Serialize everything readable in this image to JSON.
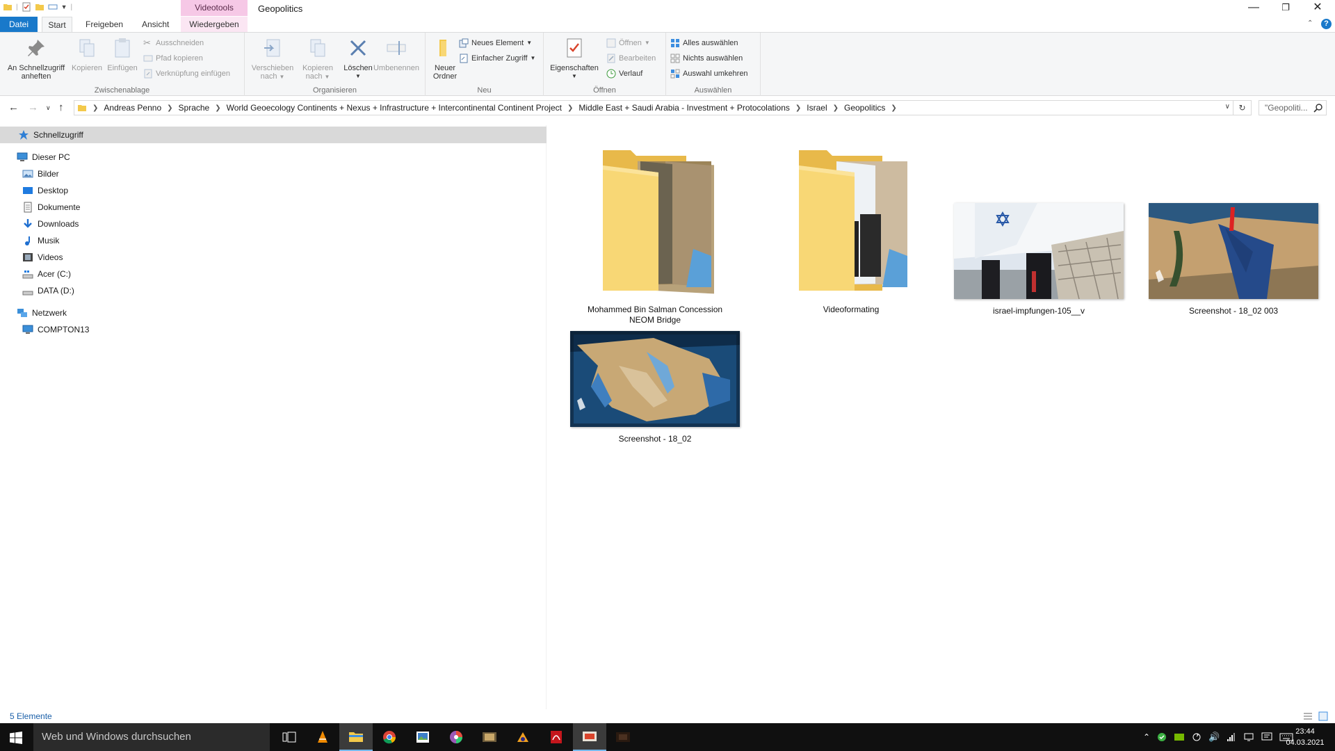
{
  "window": {
    "title": "Geopolitics",
    "context_tab_header": "Videotools"
  },
  "tabs": [
    {
      "label": "Datei"
    },
    {
      "label": "Start"
    },
    {
      "label": "Freigeben"
    },
    {
      "label": "Ansicht"
    },
    {
      "label": "Wiedergeben"
    }
  ],
  "ribbon": {
    "clipboard": {
      "group": "Zwischenablage",
      "pin_line1": "An Schnellzugriff",
      "pin_line2": "anheften",
      "copy": "Kopieren",
      "paste": "Einfügen",
      "cut": "Ausschneiden",
      "copy_path": "Pfad kopieren",
      "paste_shortcut": "Verknüpfung einfügen"
    },
    "organize": {
      "group": "Organisieren",
      "move_line1": "Verschieben",
      "move_line2": "nach",
      "copyto_line1": "Kopieren",
      "copyto_line2": "nach",
      "delete": "Löschen",
      "rename": "Umbenennen"
    },
    "new": {
      "group": "Neu",
      "folder_line1": "Neuer",
      "folder_line2": "Ordner",
      "new_item": "Neues Element",
      "easy_access": "Einfacher Zugriff"
    },
    "open": {
      "group": "Öffnen",
      "properties": "Eigenschaften",
      "open": "Öffnen",
      "edit": "Bearbeiten",
      "history": "Verlauf"
    },
    "select": {
      "group": "Auswählen",
      "all": "Alles auswählen",
      "none": "Nichts auswählen",
      "invert": "Auswahl umkehren"
    }
  },
  "address": {
    "crumbs": [
      "Andreas Penno",
      "Sprache",
      "World Geoecology Continents + Nexus + Infrastructure + Intercontinental Continent Project",
      "Middle East + Saudi Arabia - Investment + Protocolations",
      "Israel",
      "Geopolitics"
    ],
    "search_placeholder": "\"Geopoliti..."
  },
  "nav": {
    "quick_access": "Schnellzugriff",
    "this_pc": "Dieser PC",
    "pc_items": [
      "Bilder",
      "Desktop",
      "Dokumente",
      "Downloads",
      "Musik",
      "Videos",
      "Acer (C:)",
      "DATA (D:)"
    ],
    "network": "Netzwerk",
    "network_items": [
      "COMPTON13"
    ]
  },
  "items": [
    {
      "name": "Mohammed Bin Salman Concession NEOM Bridge",
      "kind": "folder"
    },
    {
      "name": "Videoformating",
      "kind": "folder"
    },
    {
      "name": "israel-impfungen-105__v",
      "kind": "image"
    },
    {
      "name": "Screenshot - 18_02 003",
      "kind": "image"
    },
    {
      "name": "Screenshot - 18_02",
      "kind": "image"
    }
  ],
  "status": {
    "count": "5 Elemente"
  },
  "taskbar": {
    "search_placeholder": "Web und Windows durchsuchen",
    "time": "23:44",
    "date": "04.03.2021"
  },
  "colors": {
    "accent": "#1979ca",
    "selection": "#d9d9d9",
    "folder": "#f8d775",
    "taskbar": "#101010"
  }
}
